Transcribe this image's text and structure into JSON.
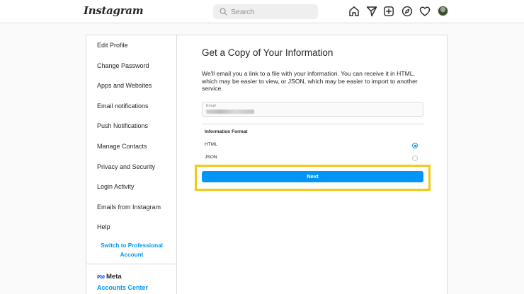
{
  "topnav": {
    "logo": "Instagram",
    "search": {
      "placeholder": "Search",
      "value": ""
    },
    "icons": [
      "home-icon",
      "direct-icon",
      "new-post-icon",
      "explore-icon",
      "activity-heart-icon",
      "profile-avatar"
    ]
  },
  "sidebar": {
    "items": [
      {
        "label": "Edit Profile"
      },
      {
        "label": "Change Password"
      },
      {
        "label": "Apps and Websites"
      },
      {
        "label": "Email notifications"
      },
      {
        "label": "Push Notifications"
      },
      {
        "label": "Manage Contacts"
      },
      {
        "label": "Privacy and Security"
      },
      {
        "label": "Login Activity"
      },
      {
        "label": "Emails from Instagram"
      },
      {
        "label": "Help"
      }
    ],
    "switch_professional_line1": "Switch to Professional",
    "switch_professional_line2": "Account",
    "meta_logo": "Meta",
    "accounts_center": "Accounts Center"
  },
  "main": {
    "title": "Get a Copy of Your Information",
    "description": "We'll email you a link to a file with your information. You can receive it in HTML, which may be easier to view, or JSON, which may be easier to import to another service.",
    "email_label": "Email",
    "format_title": "Information Format",
    "formats": [
      {
        "label": "HTML",
        "selected": true
      },
      {
        "label": "JSON",
        "selected": false
      }
    ],
    "next_label": "Next"
  },
  "colors": {
    "accent": "#0095f6",
    "highlight": "#f2c916",
    "border": "#dbdbdb",
    "background": "#fafafa"
  }
}
